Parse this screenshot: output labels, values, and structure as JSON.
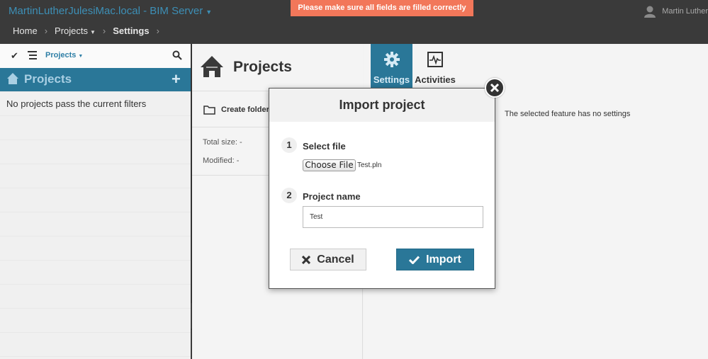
{
  "app": {
    "server_title": "MartinLutherJulesiMac.local - BIM Server",
    "toast": "Please make sure all fields are filled correctly",
    "user_name": "Martin Luther"
  },
  "breadcrumb": {
    "home": "Home",
    "projects": "Projects",
    "settings": "Settings"
  },
  "left_panel": {
    "filter_label": "Projects",
    "header_title": "Projects",
    "add_symbol": "+",
    "empty_text": "No projects pass the current filters"
  },
  "middle_panel": {
    "title": "Projects",
    "create_folder": "Create folder",
    "total_size": "Total size: -",
    "modified": "Modified: -"
  },
  "right_panel": {
    "tabs": [
      {
        "label": "Settings",
        "icon": "gear-icon",
        "active": true
      },
      {
        "label": "Activities",
        "icon": "activity-icon",
        "active": false
      }
    ],
    "note": "The selected feature has no settings"
  },
  "modal": {
    "title": "Import project",
    "step1_num": "1",
    "step1_label": "Select file",
    "choose_file": "Choose File",
    "file_name": "Test.pln",
    "step2_num": "2",
    "step2_label": "Project name",
    "project_name_value": "Test",
    "cancel_label": "Cancel",
    "import_label": "Import"
  },
  "colors": {
    "accent": "#2a7798",
    "topbar": "#3a3a3a",
    "toast": "#f2775a",
    "title_link": "#3d8fb6"
  }
}
